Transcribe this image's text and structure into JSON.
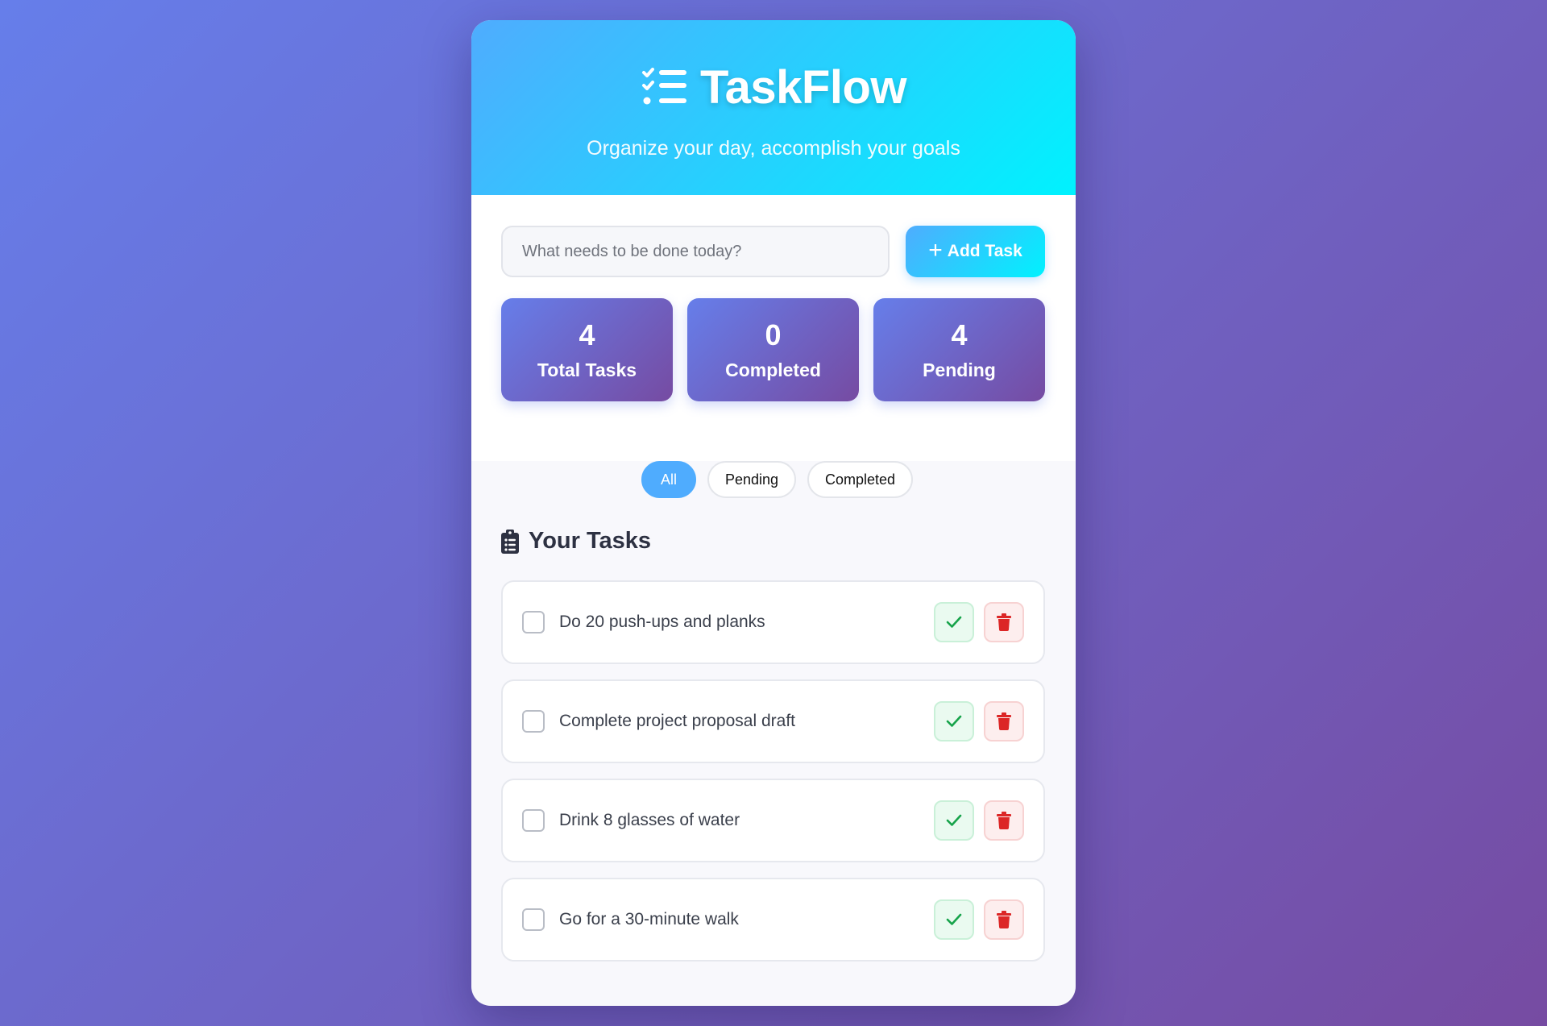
{
  "header": {
    "title": "TaskFlow",
    "subtitle": "Organize your day, accomplish your goals",
    "icon": "list-check-icon"
  },
  "input": {
    "placeholder": "What needs to be done today?",
    "value": ""
  },
  "add_button": {
    "label": "Add Task",
    "icon": "plus-icon"
  },
  "stats": [
    {
      "value": "4",
      "label": "Total Tasks"
    },
    {
      "value": "0",
      "label": "Completed"
    },
    {
      "value": "4",
      "label": "Pending"
    }
  ],
  "filters": [
    {
      "label": "All",
      "active": true
    },
    {
      "label": "Pending",
      "active": false
    },
    {
      "label": "Completed",
      "active": false
    }
  ],
  "section": {
    "title": "Your Tasks",
    "icon": "clipboard-list-icon"
  },
  "tasks": [
    {
      "text": "Do 20 push-ups and planks",
      "completed": false
    },
    {
      "text": "Complete project proposal draft",
      "completed": false
    },
    {
      "text": "Drink 8 glasses of water",
      "completed": false
    },
    {
      "text": "Go for a 30-minute walk",
      "completed": false
    }
  ],
  "colors": {
    "header_gradient_start": "#4facfe",
    "header_gradient_end": "#00f2fe",
    "stat_gradient_start": "#667eea",
    "stat_gradient_end": "#764ba2",
    "complete_green": "#16a34a",
    "delete_red": "#dc2626"
  }
}
